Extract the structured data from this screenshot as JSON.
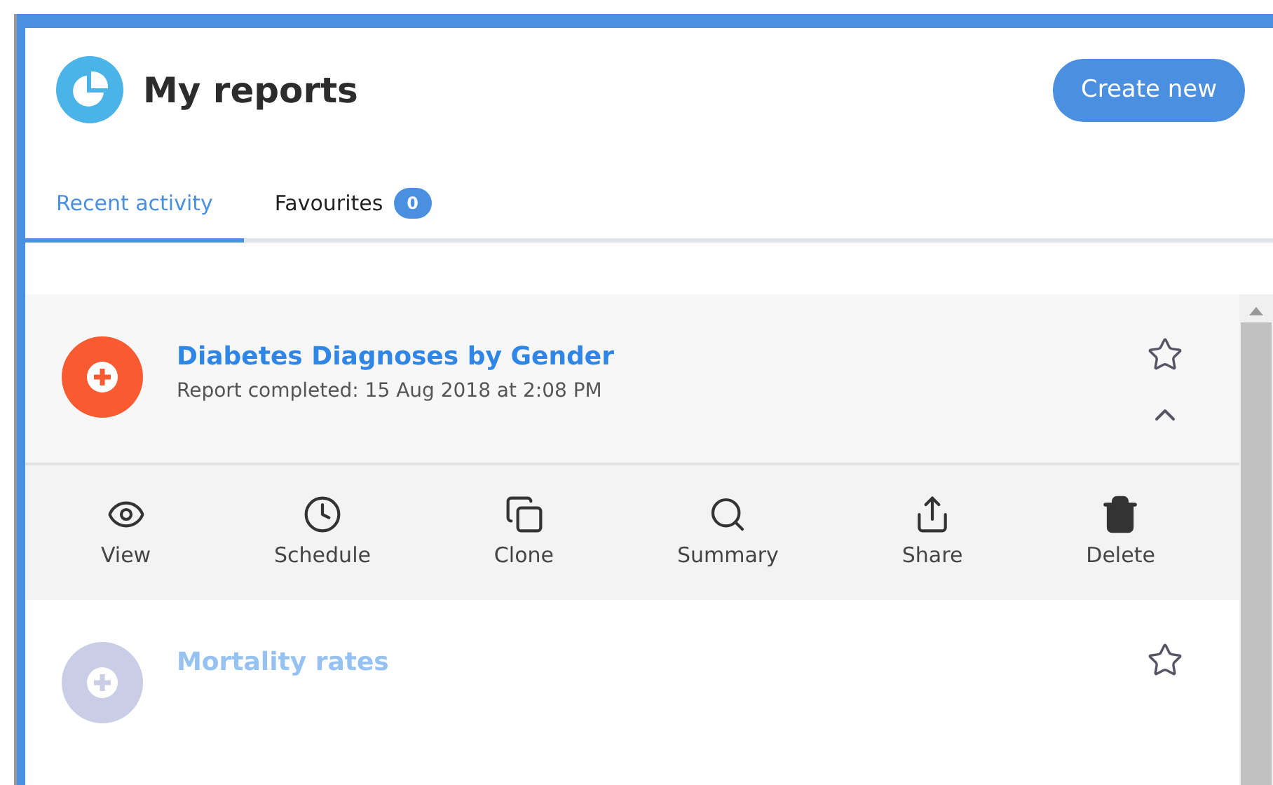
{
  "header": {
    "title": "My reports",
    "create_button": "Create new"
  },
  "tabs": [
    {
      "label": "Recent activity",
      "selected": true
    },
    {
      "label": "Favourites",
      "selected": false,
      "badge": "0"
    }
  ],
  "reports": [
    {
      "title": "Diabetes Diagnoses by Gender",
      "subtitle": "Report completed: 15 Aug 2018 at 2:08 PM",
      "color": "#fa5a32",
      "favourite": false,
      "expanded": true,
      "faded": false
    },
    {
      "title": "Mortality rates",
      "color": "#c9cde6",
      "favourite": false,
      "expanded": false,
      "faded": true
    }
  ],
  "actions": [
    {
      "kind": "view",
      "label": "View"
    },
    {
      "kind": "schedule",
      "label": "Schedule"
    },
    {
      "kind": "clone",
      "label": "Clone"
    },
    {
      "kind": "summary",
      "label": "Summary"
    },
    {
      "kind": "share",
      "label": "Share"
    },
    {
      "kind": "delete",
      "label": "Delete"
    }
  ]
}
